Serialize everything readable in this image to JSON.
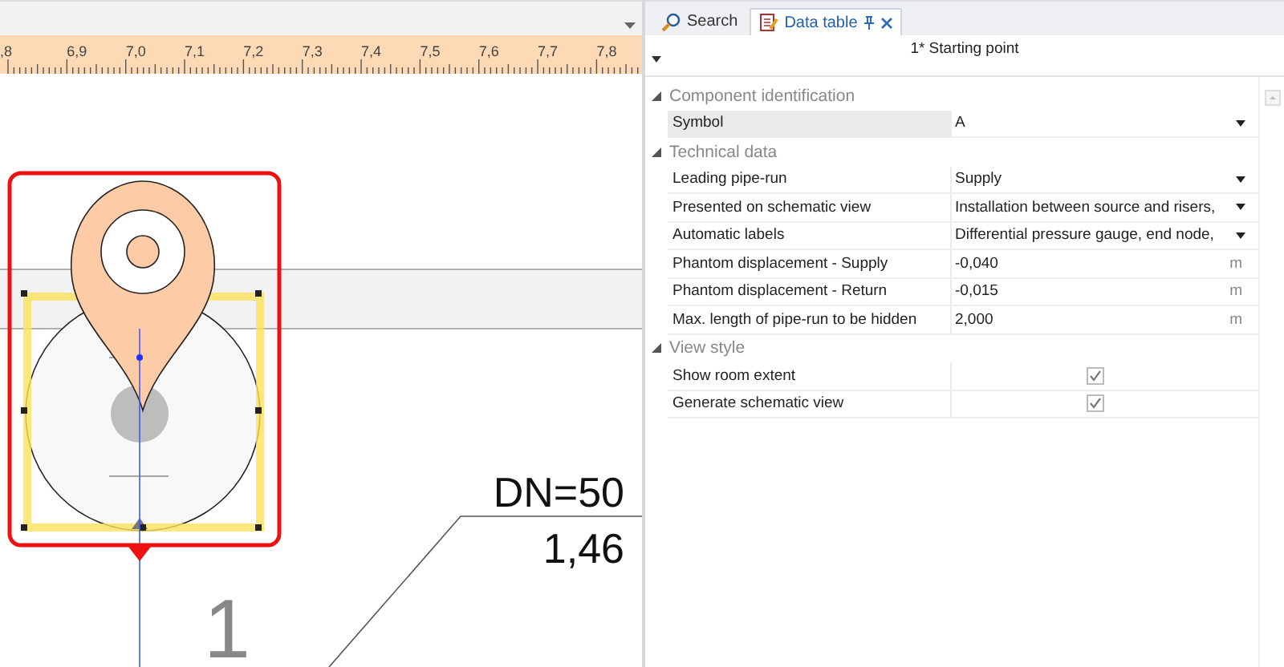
{
  "ruler": {
    "labels": [
      ",8",
      "6,9",
      "7,0",
      "7,1",
      "7,2",
      "7,3",
      "7,4",
      "7,5",
      "7,6",
      "7,7",
      "7,8"
    ]
  },
  "drawing": {
    "node_number": "1",
    "dimension": "DN=50",
    "length": "1,46"
  },
  "panel": {
    "tabs": [
      {
        "label": "Search",
        "selected": false,
        "kind": "search"
      },
      {
        "label": "Data table",
        "selected": true,
        "kind": "table"
      }
    ],
    "title": "1* Starting point",
    "categories": [
      {
        "title": "Component identification",
        "expanded": true,
        "rows": [
          {
            "label": "Symbol",
            "value": "A",
            "kind": "dropdown",
            "selected": true
          }
        ]
      },
      {
        "title": "Technical data",
        "expanded": true,
        "rows": [
          {
            "label": "Leading pipe-run",
            "value": "Supply",
            "kind": "dropdown",
            "selected": false
          },
          {
            "label": "Presented on schematic view",
            "value": "Installation between source and risers,",
            "kind": "dropdown",
            "selected": false
          },
          {
            "label": "Automatic labels",
            "value": "Differential pressure gauge, end node,",
            "kind": "dropdown",
            "selected": false
          },
          {
            "label": "Phantom displacement - Supply",
            "value": "-0,040",
            "unit": "m",
            "kind": "number",
            "selected": false
          },
          {
            "label": "Phantom displacement - Return",
            "value": "-0,015",
            "unit": "m",
            "kind": "number",
            "selected": false
          },
          {
            "label": "Max. length of pipe-run to be hidden",
            "value": "2,000",
            "unit": "m",
            "kind": "number",
            "selected": false
          }
        ]
      },
      {
        "title": "View style",
        "expanded": true,
        "rows": [
          {
            "label": "Show room extent",
            "checked": true,
            "kind": "checkbox",
            "selected": false
          },
          {
            "label": "Generate schematic view",
            "checked": true,
            "kind": "checkbox",
            "selected": false
          }
        ]
      }
    ]
  }
}
